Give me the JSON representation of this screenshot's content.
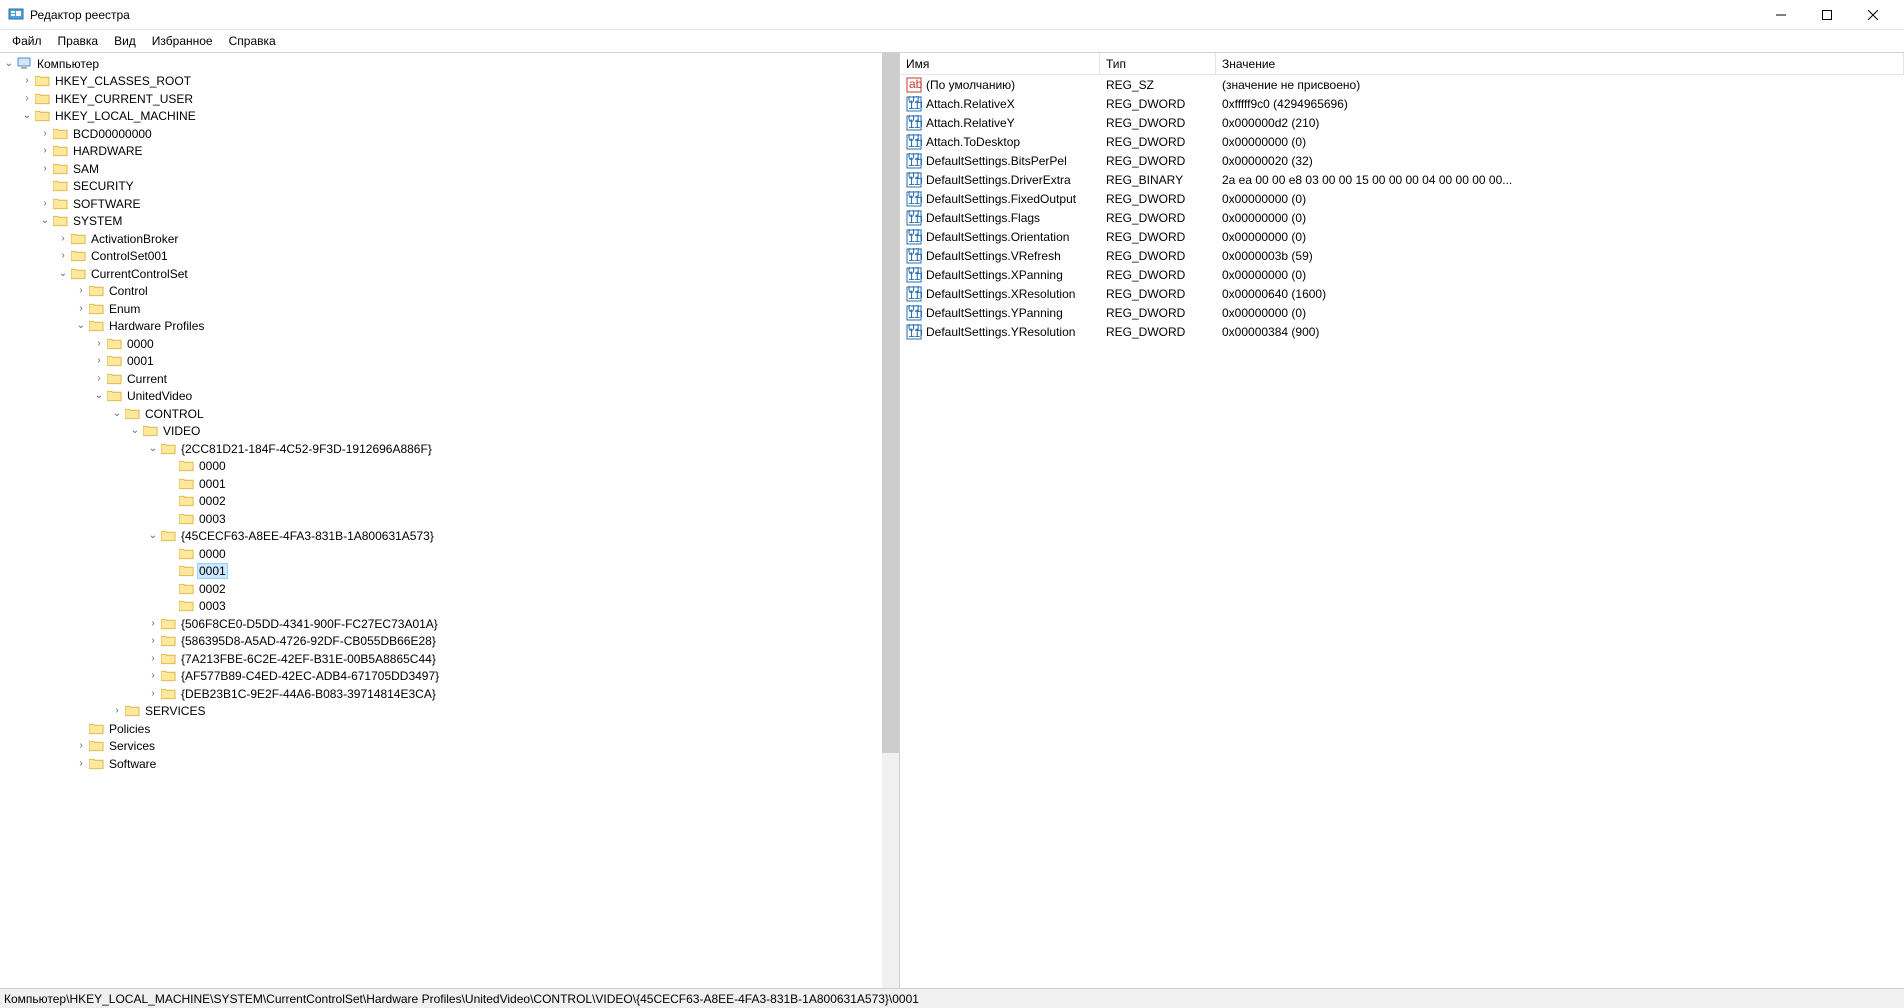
{
  "titlebar": {
    "title": "Редактор реестра"
  },
  "menubar": {
    "file": "Файл",
    "edit": "Правка",
    "view": "Вид",
    "favorites": "Избранное",
    "help": "Справка"
  },
  "tree": [
    {
      "depth": 0,
      "twisty": "open",
      "icon": "computer",
      "label": "Компьютер"
    },
    {
      "depth": 1,
      "twisty": "closed",
      "icon": "folder",
      "label": "HKEY_CLASSES_ROOT"
    },
    {
      "depth": 1,
      "twisty": "closed",
      "icon": "folder",
      "label": "HKEY_CURRENT_USER"
    },
    {
      "depth": 1,
      "twisty": "open",
      "icon": "folder",
      "label": "HKEY_LOCAL_MACHINE"
    },
    {
      "depth": 2,
      "twisty": "closed",
      "icon": "folder",
      "label": "BCD00000000"
    },
    {
      "depth": 2,
      "twisty": "closed",
      "icon": "folder",
      "label": "HARDWARE"
    },
    {
      "depth": 2,
      "twisty": "closed",
      "icon": "folder",
      "label": "SAM"
    },
    {
      "depth": 2,
      "twisty": "none",
      "icon": "folder",
      "label": "SECURITY"
    },
    {
      "depth": 2,
      "twisty": "closed",
      "icon": "folder",
      "label": "SOFTWARE"
    },
    {
      "depth": 2,
      "twisty": "open",
      "icon": "folder",
      "label": "SYSTEM"
    },
    {
      "depth": 3,
      "twisty": "closed",
      "icon": "folder",
      "label": "ActivationBroker"
    },
    {
      "depth": 3,
      "twisty": "closed",
      "icon": "folder",
      "label": "ControlSet001"
    },
    {
      "depth": 3,
      "twisty": "open",
      "icon": "folder",
      "label": "CurrentControlSet"
    },
    {
      "depth": 4,
      "twisty": "closed",
      "icon": "folder",
      "label": "Control"
    },
    {
      "depth": 4,
      "twisty": "closed",
      "icon": "folder",
      "label": "Enum"
    },
    {
      "depth": 4,
      "twisty": "open",
      "icon": "folder",
      "label": "Hardware Profiles"
    },
    {
      "depth": 5,
      "twisty": "closed",
      "icon": "folder",
      "label": "0000"
    },
    {
      "depth": 5,
      "twisty": "closed",
      "icon": "folder",
      "label": "0001"
    },
    {
      "depth": 5,
      "twisty": "closed",
      "icon": "folder",
      "label": "Current"
    },
    {
      "depth": 5,
      "twisty": "open",
      "icon": "folder",
      "label": "UnitedVideo"
    },
    {
      "depth": 6,
      "twisty": "open",
      "icon": "folder",
      "label": "CONTROL"
    },
    {
      "depth": 7,
      "twisty": "open",
      "icon": "folder",
      "label": "VIDEO"
    },
    {
      "depth": 8,
      "twisty": "open",
      "icon": "folder",
      "label": "{2CC81D21-184F-4C52-9F3D-1912696A886F}"
    },
    {
      "depth": 9,
      "twisty": "none",
      "icon": "folder",
      "label": "0000"
    },
    {
      "depth": 9,
      "twisty": "none",
      "icon": "folder",
      "label": "0001"
    },
    {
      "depth": 9,
      "twisty": "none",
      "icon": "folder",
      "label": "0002"
    },
    {
      "depth": 9,
      "twisty": "none",
      "icon": "folder",
      "label": "0003"
    },
    {
      "depth": 8,
      "twisty": "open",
      "icon": "folder",
      "label": "{45CECF63-A8EE-4FA3-831B-1A800631A573}"
    },
    {
      "depth": 9,
      "twisty": "none",
      "icon": "folder",
      "label": "0000"
    },
    {
      "depth": 9,
      "twisty": "none",
      "icon": "folder",
      "label": "0001",
      "selected": true
    },
    {
      "depth": 9,
      "twisty": "none",
      "icon": "folder",
      "label": "0002"
    },
    {
      "depth": 9,
      "twisty": "none",
      "icon": "folder",
      "label": "0003"
    },
    {
      "depth": 8,
      "twisty": "closed",
      "icon": "folder",
      "label": "{506F8CE0-D5DD-4341-900F-FC27EC73A01A}"
    },
    {
      "depth": 8,
      "twisty": "closed",
      "icon": "folder",
      "label": "{586395D8-A5AD-4726-92DF-CB055DB66E28}"
    },
    {
      "depth": 8,
      "twisty": "closed",
      "icon": "folder",
      "label": "{7A213FBE-6C2E-42EF-B31E-00B5A8865C44}"
    },
    {
      "depth": 8,
      "twisty": "closed",
      "icon": "folder",
      "label": "{AF577B89-C4ED-42EC-ADB4-671705DD3497}"
    },
    {
      "depth": 8,
      "twisty": "closed",
      "icon": "folder",
      "label": "{DEB23B1C-9E2F-44A6-B083-39714814E3CA}"
    },
    {
      "depth": 6,
      "twisty": "closed",
      "icon": "folder",
      "label": "SERVICES"
    },
    {
      "depth": 4,
      "twisty": "none",
      "icon": "folder",
      "label": "Policies"
    },
    {
      "depth": 4,
      "twisty": "closed",
      "icon": "folder",
      "label": "Services"
    },
    {
      "depth": 4,
      "twisty": "closed",
      "icon": "folder",
      "label": "Software"
    }
  ],
  "values_header": {
    "name": "Имя",
    "type": "Тип",
    "value": "Значение"
  },
  "values": [
    {
      "icon": "sz",
      "name": "(По умолчанию)",
      "type": "REG_SZ",
      "value": "(значение не присвоено)"
    },
    {
      "icon": "bin",
      "name": "Attach.RelativeX",
      "type": "REG_DWORD",
      "value": "0xfffff9c0 (4294965696)"
    },
    {
      "icon": "bin",
      "name": "Attach.RelativeY",
      "type": "REG_DWORD",
      "value": "0x000000d2 (210)"
    },
    {
      "icon": "bin",
      "name": "Attach.ToDesktop",
      "type": "REG_DWORD",
      "value": "0x00000000 (0)"
    },
    {
      "icon": "bin",
      "name": "DefaultSettings.BitsPerPel",
      "type": "REG_DWORD",
      "value": "0x00000020 (32)"
    },
    {
      "icon": "bin",
      "name": "DefaultSettings.DriverExtra",
      "type": "REG_BINARY",
      "value": "2a ea 00 00 e8 03 00 00 15 00 00 00 04 00 00 00 00..."
    },
    {
      "icon": "bin",
      "name": "DefaultSettings.FixedOutput",
      "type": "REG_DWORD",
      "value": "0x00000000 (0)"
    },
    {
      "icon": "bin",
      "name": "DefaultSettings.Flags",
      "type": "REG_DWORD",
      "value": "0x00000000 (0)"
    },
    {
      "icon": "bin",
      "name": "DefaultSettings.Orientation",
      "type": "REG_DWORD",
      "value": "0x00000000 (0)"
    },
    {
      "icon": "bin",
      "name": "DefaultSettings.VRefresh",
      "type": "REG_DWORD",
      "value": "0x0000003b (59)"
    },
    {
      "icon": "bin",
      "name": "DefaultSettings.XPanning",
      "type": "REG_DWORD",
      "value": "0x00000000 (0)"
    },
    {
      "icon": "bin",
      "name": "DefaultSettings.XResolution",
      "type": "REG_DWORD",
      "value": "0x00000640 (1600)"
    },
    {
      "icon": "bin",
      "name": "DefaultSettings.YPanning",
      "type": "REG_DWORD",
      "value": "0x00000000 (0)"
    },
    {
      "icon": "bin",
      "name": "DefaultSettings.YResolution",
      "type": "REG_DWORD",
      "value": "0x00000384 (900)"
    }
  ],
  "statusbar": {
    "path": "Компьютер\\HKEY_LOCAL_MACHINE\\SYSTEM\\CurrentControlSet\\Hardware Profiles\\UnitedVideo\\CONTROL\\VIDEO\\{45CECF63-A8EE-4FA3-831B-1A800631A573}\\0001"
  }
}
